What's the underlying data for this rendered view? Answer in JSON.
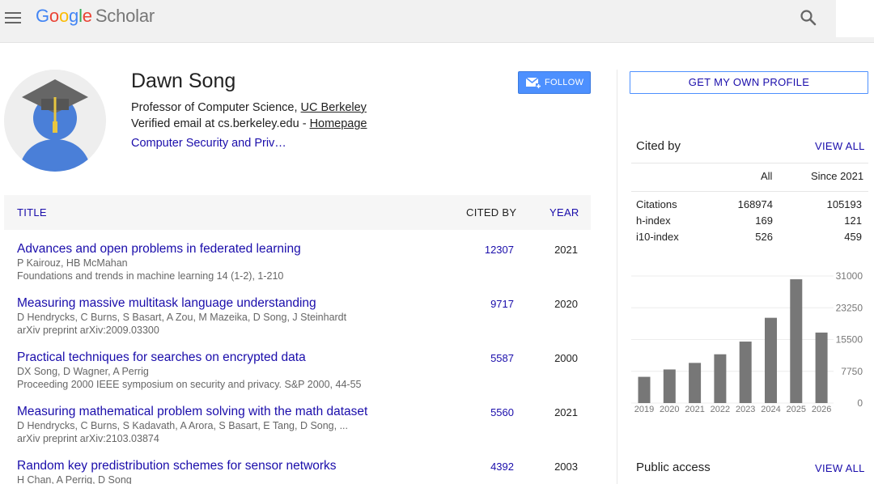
{
  "header": {
    "logo_letters": [
      "G",
      "o",
      "o",
      "g",
      "l",
      "e"
    ],
    "logo_suffix": "Scholar"
  },
  "profile": {
    "name": "Dawn Song",
    "affiliation_prefix": "Professor of Computer Science, ",
    "affiliation_link": "UC Berkeley",
    "verified_prefix": "Verified email at cs.berkeley.edu - ",
    "homepage_link": "Homepage",
    "interests": "Computer Security and Priv…",
    "follow_label": "FOLLOW"
  },
  "table": {
    "col_title": "TITLE",
    "col_cited": "CITED BY",
    "col_year": "YEAR",
    "rows": [
      {
        "title": "Advances and open problems in federated learning",
        "authors": "P Kairouz, HB McMahan",
        "venue": "Foundations and trends in machine learning 14 (1-2), 1-210",
        "cited": "12307",
        "year": "2021"
      },
      {
        "title": "Measuring massive multitask language understanding",
        "authors": "D Hendrycks, C Burns, S Basart, A Zou, M Mazeika, D Song, J Steinhardt",
        "venue": "arXiv preprint arXiv:2009.03300",
        "cited": "9717",
        "year": "2020"
      },
      {
        "title": "Practical techniques for searches on encrypted data",
        "authors": "DX Song, D Wagner, A Perrig",
        "venue": "Proceeding 2000 IEEE symposium on security and privacy. S&P 2000, 44-55",
        "cited": "5587",
        "year": "2000"
      },
      {
        "title": "Measuring mathematical problem solving with the math dataset",
        "authors": "D Hendrycks, C Burns, S Kadavath, A Arora, S Basart, E Tang, D Song, ...",
        "venue": "arXiv preprint arXiv:2103.03874",
        "cited": "5560",
        "year": "2021"
      },
      {
        "title": "Random key predistribution schemes for sensor networks",
        "authors": "H Chan, A Perrig, D Song",
        "venue": "",
        "cited": "4392",
        "year": "2003"
      }
    ]
  },
  "sidebar": {
    "get_profile_label": "GET MY OWN PROFILE",
    "cited_by_title": "Cited by",
    "view_all": "VIEW ALL",
    "col_all": "All",
    "col_since": "Since 2021",
    "stats": [
      {
        "label": "Citations",
        "all": "168974",
        "since": "105193"
      },
      {
        "label": "h-index",
        "all": "169",
        "since": "121"
      },
      {
        "label": "i10-index",
        "all": "526",
        "since": "459"
      }
    ],
    "public_access_title": "Public access"
  },
  "chart_data": {
    "type": "bar",
    "categories": [
      "2019",
      "2020",
      "2021",
      "2022",
      "2023",
      "2024",
      "2025",
      "2026"
    ],
    "values": [
      6400,
      8200,
      9800,
      11900,
      15000,
      20800,
      30200,
      17200
    ],
    "ylim": [
      0,
      31000
    ],
    "yticks": [
      "0",
      "7750",
      "15500",
      "23250",
      "31000"
    ],
    "bar_color": "#777777"
  }
}
